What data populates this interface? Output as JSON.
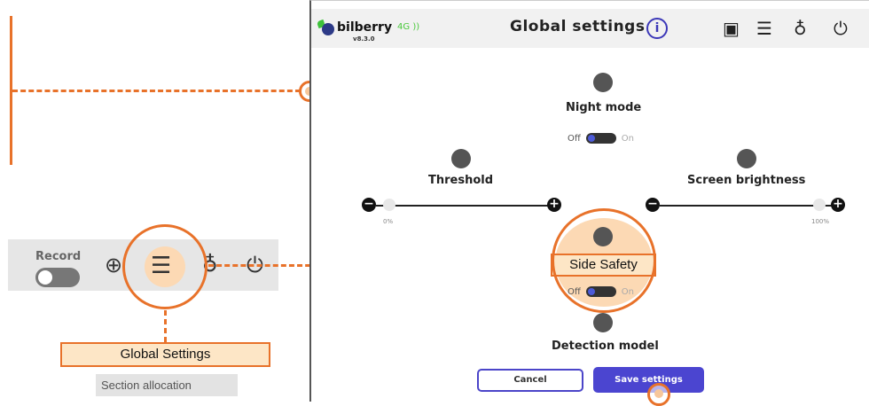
{
  "toolbar": {
    "record_label": "Record",
    "icons": [
      "help-lifebuoy-icon",
      "sliders-icon",
      "user-icon",
      "power-icon"
    ]
  },
  "callouts": {
    "global_settings": "Global Settings",
    "side_safety": "Side Safety",
    "section_allocation": "Section allocation"
  },
  "app": {
    "logo": "bilberry",
    "version": "v8.3.0",
    "network": "4G",
    "title": "Global settings",
    "info_icon": "i",
    "night_mode": {
      "title": "Night mode",
      "off": "Off",
      "on": "On",
      "value": "Off"
    },
    "threshold": {
      "title": "Threshold",
      "min_label": "0%"
    },
    "screen_brightness": {
      "title": "Screen brightness",
      "max_label": "100%"
    },
    "side_safety": {
      "off": "Off",
      "on": "On",
      "value": "Off"
    },
    "detection_model": {
      "title": "Detection model"
    },
    "cancel_label": "Cancel",
    "save_label": "Save settings"
  },
  "colors": {
    "accent_orange": "#e8722a",
    "brand_purple": "#4b45d0",
    "highlight_fill": "#fde6c6"
  }
}
